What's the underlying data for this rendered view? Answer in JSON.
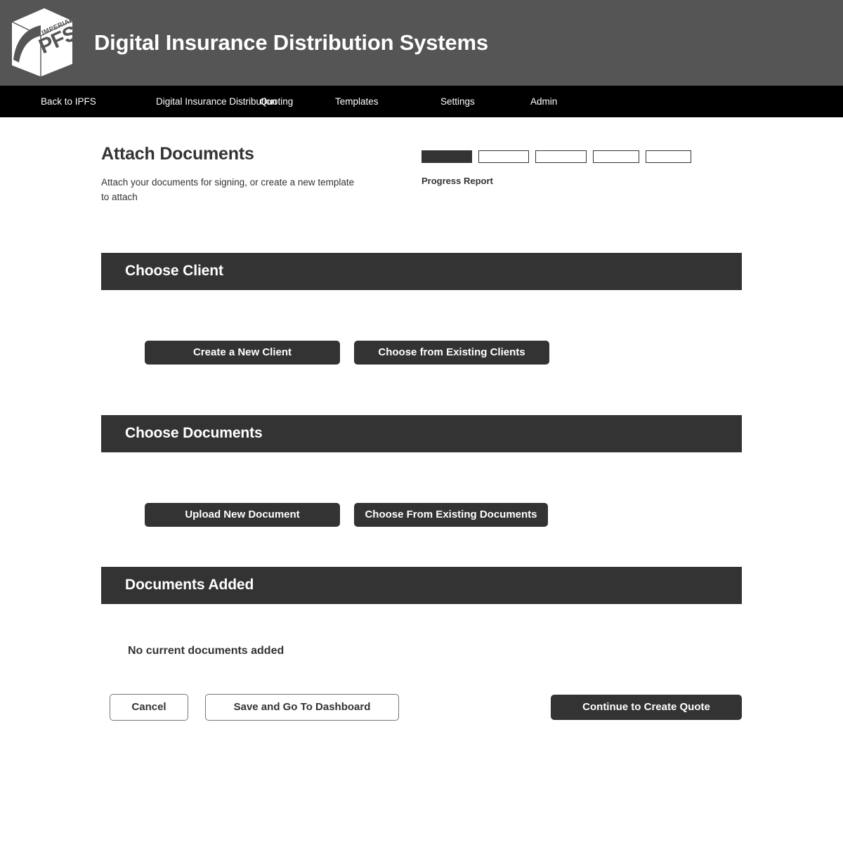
{
  "header": {
    "logo_name": "imperial-pfs-logo",
    "logo_text_top": "IMPERIAL",
    "logo_text_main": "PFS",
    "logo_registered": "®",
    "title": "Digital Insurance Distribution Systems",
    "background_color": "#555555"
  },
  "nav": {
    "background_color": "#000000",
    "items": [
      {
        "label": "Back to IPFS"
      },
      {
        "label": "Digital Insurance Distribution"
      },
      {
        "label": "Quoting"
      },
      {
        "label": "Templates"
      },
      {
        "label": "Settings"
      },
      {
        "label": "Admin"
      }
    ]
  },
  "main": {
    "page_title": "Attach Documents",
    "page_subtitle": "Attach your documents for signing, or create a new template to attach",
    "progress": {
      "label": "Progress Report",
      "total_steps": 5,
      "completed_steps": 1,
      "fill_color": "#333333",
      "segments": [
        {
          "filled": true
        },
        {
          "filled": false
        },
        {
          "filled": false
        },
        {
          "filled": false
        },
        {
          "filled": false
        }
      ]
    },
    "sections": [
      {
        "id": "choose-client",
        "heading": "Choose Client",
        "buttons": [
          {
            "label": "Create a New Client",
            "style": "dark"
          },
          {
            "label": "Choose from Existing Clients",
            "style": "dark"
          }
        ]
      },
      {
        "id": "choose-documents",
        "heading": "Choose Documents",
        "buttons": [
          {
            "label": "Upload New Document",
            "style": "dark"
          },
          {
            "label": "Choose From Existing Documents",
            "style": "dark"
          }
        ]
      },
      {
        "id": "documents-added",
        "heading": "Documents Added",
        "empty_message": "No current documents added"
      }
    ],
    "footer_buttons": {
      "cancel": "Cancel",
      "save": "Save and Go To Dashboard",
      "continue": "Continue to Create Quote"
    },
    "accent_color": "#333333"
  }
}
